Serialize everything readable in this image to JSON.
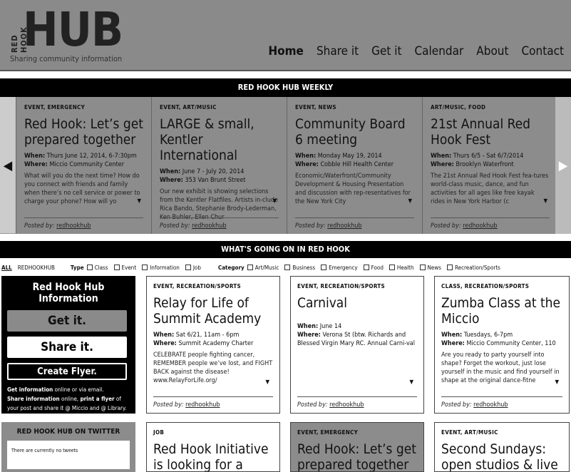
{
  "header": {
    "logo_side": "RED HOOK",
    "logo_main": "HUB",
    "tagline": "Sharing community information",
    "nav": [
      "Home",
      "Share it",
      "Get it",
      "Calendar",
      "About",
      "Contact"
    ]
  },
  "weekly": {
    "title": "RED HOOK HUB WEEKLY",
    "cards": [
      {
        "category": "EVENT, EMERGENCY",
        "title": "Red Hook: Let’s get prepared together",
        "when_label": "When:",
        "when": "Thurs June 12, 2014, 6-7:30pm",
        "where_label": "Where:",
        "where": "Miccio Community Center",
        "desc": "What will you do the next time? How do you connect with friends and family when there’s no cell service or power to charge your phone? How will yo",
        "posted_label": "Posted by:",
        "posted_by": "redhookhub"
      },
      {
        "category": "EVENT, ART/MUSIC",
        "title": "LARGE & small, Kentler International",
        "when_label": "When:",
        "when": "June 7 - July 20, 2014",
        "where_label": "Where:",
        "where": "353 Van Brunt Street",
        "desc": "Our new exhibit is showing selections from the Kentler Flatfiles. Artists in-clude Rica Bando, Stephanie Brody-Lederman, Ken Buhler, Ellen Chur",
        "posted_label": "Posted by:",
        "posted_by": "redhookhub"
      },
      {
        "category": "EVENT, NEWS",
        "title": "Community Board 6 meeting",
        "when_label": "When:",
        "when": "Monday May 19, 2014",
        "where_label": "Where:",
        "where": "Cobble Hill Health Center",
        "desc": "Economic/Waterfront/Community Development & Housing Presentation and discussion with rep-resentatives for the New York City",
        "posted_label": "Posted by:",
        "posted_by": "redhookhub"
      },
      {
        "category": "ART/MUSIC, FOOD",
        "title": "21st Annual Red Hook Fest",
        "when_label": "When:",
        "when": "Thurs 6/5 - Sat 6/7/2014",
        "where_label": "Where:",
        "where": "Brooklyn Waterfront",
        "desc": "The 21st Annual Red Hook Fest fea-tures world-class music, dance, and fun activities for all ages like free kayak rides in New York Harbor (c",
        "posted_label": "Posted by:",
        "posted_by": "redhookhub"
      }
    ]
  },
  "going": {
    "title": "WHAT'S GOING ON IN RED HOOK",
    "filters": {
      "all": "ALL",
      "redhookhub": "REDHOOKHUB",
      "type_label": "Type",
      "types": [
        "Class",
        "Event",
        "Information",
        "Job"
      ],
      "category_label": "Category",
      "categories": [
        "Art/Music",
        "Business",
        "Emergency",
        "Food",
        "Health",
        "News",
        "Recreation/Sports"
      ]
    }
  },
  "infobox": {
    "title": "Red Hook Hub Information",
    "get_label": "Get it.",
    "share_label": "Share it.",
    "flyer_label": "Create Flyer.",
    "foot_b1": "Get information",
    "foot_t1": " online or via email.",
    "foot_b2": "Share information",
    "foot_t2": " online, ",
    "foot_b3": "print a flyer",
    "foot_t3": " of your post and share it @ Miccio and @ Library."
  },
  "events": [
    {
      "category": "EVENT, RECREATION/SPORTS",
      "title": "Relay for Life of Summit Academy",
      "when_label": "When:",
      "when": "Sat 6/21, 11am - 6pm",
      "where_label": "Where:",
      "where": "Summit Academy Charter",
      "desc": "CELEBRATE people fighting cancer, REMEMBER people we’ve lost, and FIGHT BACK against the disease! www.RelayForLife.org/",
      "posted_label": "Posted by:",
      "posted_by": "redhookhub"
    },
    {
      "category": "EVENT, RECREATION/SPORTS",
      "title": "Carnival",
      "when_label": "When:",
      "when": "June 14",
      "where_label": "Where:",
      "where": "Verona St (btw. Richards and Blessed Virgin Mary RC. Annual Carni-val",
      "desc": "",
      "posted_label": "Posted by:",
      "posted_by": "redhookhub"
    },
    {
      "category": "CLASS, RECREATION/SPORTS",
      "title": "Zumba Class at the Miccio",
      "when_label": "When:",
      "when": "Tuesdays, 6-7pm",
      "where_label": "Where:",
      "where": "Miccio Community Center, 110",
      "desc": "Are you ready to party yourself into shape? Forget the workout, just lose yourself in the music and find yourself in shape at the original dance-fitne",
      "posted_label": "Posted by:",
      "posted_by": "redhookhub"
    }
  ],
  "twitter": {
    "title": "RED HOOK HUB ON TWITTER",
    "body": "There are currently no tweets"
  },
  "bottom": [
    {
      "category": "JOB",
      "title": "Red Hook Initiative is looking for a COO"
    },
    {
      "category": "EVENT, EMERGENCY",
      "title": "Red Hook: Let’s get prepared together"
    },
    {
      "category": "EVENT, ART/MUSIC",
      "title": "Second Sundays: open studios & live"
    }
  ],
  "icons": {
    "left": "left-arrow-icon",
    "right": "right-arrow-icon",
    "more": "chevron-down-icon"
  }
}
